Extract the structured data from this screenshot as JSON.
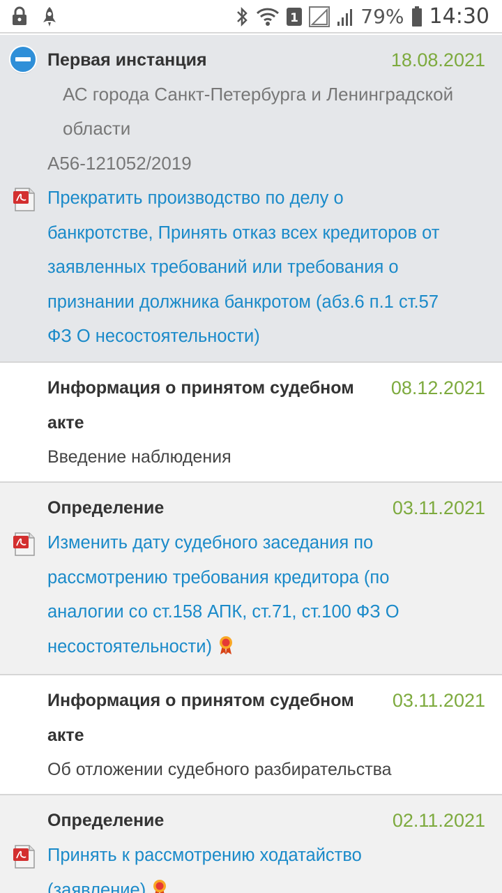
{
  "status_bar": {
    "battery": "79%",
    "time": "14:30",
    "sim_badge": "1",
    "icons": [
      "lock-icon",
      "rocket-icon",
      "bluetooth-icon",
      "wifi-icon",
      "sim-badge",
      "signal-empty-icon",
      "signal-icon",
      "battery-icon"
    ]
  },
  "items": [
    {
      "title": "Первая инстанция",
      "date": "18.08.2021",
      "court_line1": "АС города Санкт-Петербурга и Ленинградской",
      "court_line2": "области",
      "case_number": "А56-121052/2019",
      "link_lines": [
        "Прекратить производство по делу о",
        "банкротстве, Принять отказ всех кредиторов от",
        "заявленных требований или требования о",
        "признании должника банкротом (абз.6 п.1 ст.57",
        "ФЗ О несостоятельности)"
      ]
    },
    {
      "title_line1": "Информация о принятом судебном",
      "title_line2": "акте",
      "date": "08.12.2021",
      "text": "Введение наблюдения"
    },
    {
      "title": "Определение",
      "date": "03.11.2021",
      "link_lines": [
        "Изменить дату судебного заседания по",
        "рассмотрению требования кредитора (по",
        "аналогии со ст.158 АПК, ст.71, ст.100 ФЗ О",
        "несостоятельности)"
      ]
    },
    {
      "title_line1": "Информация о принятом судебном",
      "title_line2": "акте",
      "date": "03.11.2021",
      "text": "Об отложении судебного разбирательства"
    },
    {
      "title": "Определение",
      "date": "02.11.2021",
      "link_lines": [
        "Принять к рассмотрению ходатайство",
        "(заявление)"
      ]
    }
  ],
  "colors": {
    "link": "#1a8ac9",
    "date": "#7daa3e",
    "highlight_bg": "#e5e7ea",
    "alt_bg": "#f1f1f1"
  }
}
